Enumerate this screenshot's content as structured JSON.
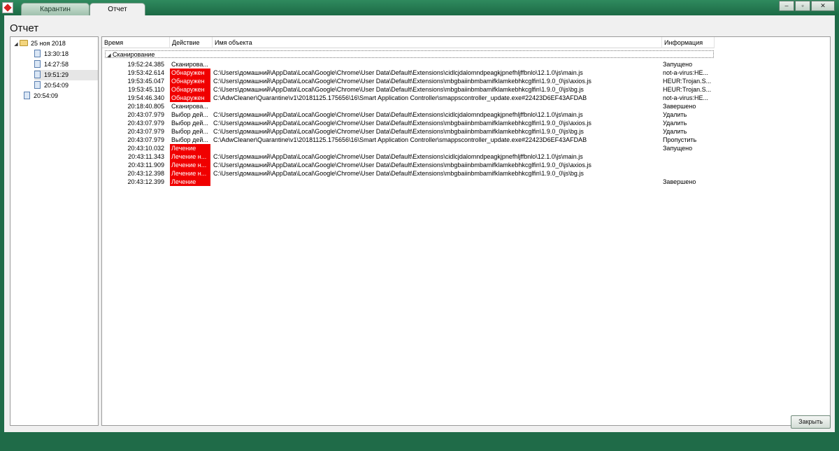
{
  "window": {
    "tabs": [
      {
        "label": "Карантин"
      },
      {
        "label": "Отчет"
      }
    ],
    "controls": {
      "minimize": "–",
      "restore": "▫",
      "close": "✕"
    }
  },
  "page": {
    "title": "Отчет"
  },
  "tree": {
    "root": "25 ноя 2018",
    "children": [
      "13:30:18",
      "14:27:58",
      "19:51:29",
      "20:54:09"
    ],
    "extra": "20:54:09",
    "selected": "19:51:29"
  },
  "grid": {
    "columns": {
      "time": "Время",
      "action": "Действие",
      "object": "Имя объекта",
      "info": "Информация"
    },
    "group": "Сканирование",
    "rows": [
      {
        "time": "19:52:24.385",
        "action": "Сканирова...",
        "object": "",
        "info": "Запущено"
      },
      {
        "time": "19:53:42.614",
        "action": "Обнаружен",
        "object": "C:\\Users\\домашний\\AppData\\Local\\Google\\Chrome\\User Data\\Default\\Extensions\\cidlcjdalomndpeagkjpnefhljffbnlo\\12.1.0\\js\\main.js",
        "info": "not-a-virus:HE..."
      },
      {
        "time": "19:53:45.047",
        "action": "Обнаружен",
        "object": "C:\\Users\\домашний\\AppData\\Local\\Google\\Chrome\\User Data\\Default\\Extensions\\mbgbaiinbmbamifklamkebhkcglfin\\1.9.0_0\\js\\axios.js",
        "info": "HEUR:Trojan.S..."
      },
      {
        "time": "19:53:45.110",
        "action": "Обнаружен",
        "object": "C:\\Users\\домашний\\AppData\\Local\\Google\\Chrome\\User Data\\Default\\Extensions\\mbgbaiinbmbamifklamkebhkcglfin\\1.9.0_0\\js\\bg.js",
        "info": "HEUR:Trojan.S..."
      },
      {
        "time": "19:54:46.340",
        "action": "Обнаружен",
        "object": "C:\\AdwCleaner\\Quarantine\\v1\\20181125.175656\\16\\Smart Application Controller\\smappscontroller_update.exe#22423D6EF43AFDAB",
        "info": "not-a-virus:HE..."
      },
      {
        "time": "20:18:40.805",
        "action": "Сканирова...",
        "object": "",
        "info": "Завершено"
      },
      {
        "time": "20:43:07.979",
        "action": "Выбор дей...",
        "object": "C:\\Users\\домашний\\AppData\\Local\\Google\\Chrome\\User Data\\Default\\Extensions\\cidlcjdalomndpeagkjpnefhljffbnlo\\12.1.0\\js\\main.js",
        "info": "Удалить"
      },
      {
        "time": "20:43:07.979",
        "action": "Выбор дей...",
        "object": "C:\\Users\\домашний\\AppData\\Local\\Google\\Chrome\\User Data\\Default\\Extensions\\mbgbaiinbmbamifklamkebhkcglfin\\1.9.0_0\\js\\axios.js",
        "info": "Удалить"
      },
      {
        "time": "20:43:07.979",
        "action": "Выбор дей...",
        "object": "C:\\Users\\домашний\\AppData\\Local\\Google\\Chrome\\User Data\\Default\\Extensions\\mbgbaiinbmbamifklamkebhkcglfin\\1.9.0_0\\js\\bg.js",
        "info": "Удалить"
      },
      {
        "time": "20:43:07.979",
        "action": "Выбор дей...",
        "object": "C:\\AdwCleaner\\Quarantine\\v1\\20181125.175656\\16\\Smart Application Controller\\smappscontroller_update.exe#22423D6EF43AFDAB",
        "info": "Пропустить"
      },
      {
        "time": "20:43:10.032",
        "action": "Лечение",
        "object": "",
        "info": "Запущено"
      },
      {
        "time": "20:43:11.343",
        "action": "Лечение н...",
        "object": "C:\\Users\\домашний\\AppData\\Local\\Google\\Chrome\\User Data\\Default\\Extensions\\cidlcjdalomndpeagkjpnefhljffbnlo\\12.1.0\\js\\main.js",
        "info": ""
      },
      {
        "time": "20:43:11.909",
        "action": "Лечение н...",
        "object": "C:\\Users\\домашний\\AppData\\Local\\Google\\Chrome\\User Data\\Default\\Extensions\\mbgbaiinbmbamifklamkebhkcglfin\\1.9.0_0\\js\\axios.js",
        "info": ""
      },
      {
        "time": "20:43:12.398",
        "action": "Лечение н...",
        "object": "C:\\Users\\домашний\\AppData\\Local\\Google\\Chrome\\User Data\\Default\\Extensions\\mbgbaiinbmbamifklamkebhkcglfin\\1.9.0_0\\js\\bg.js",
        "info": ""
      },
      {
        "time": "20:43:12.399",
        "action": "Лечение",
        "object": "",
        "info": "Завершено"
      }
    ],
    "highlight_color": "#f00000"
  },
  "footer": {
    "close_label": "Закрыть"
  }
}
